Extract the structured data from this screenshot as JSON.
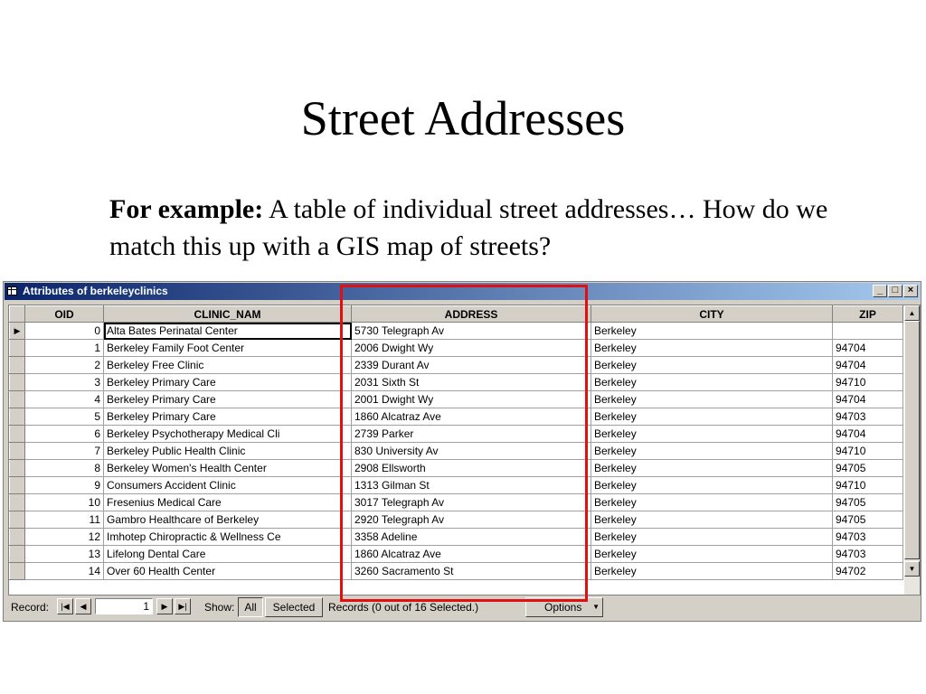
{
  "slide": {
    "title": "Street Addresses",
    "body_bold": "For example:",
    "body_text": " A table of individual street addresses… How do we match this up with a GIS map of streets?"
  },
  "window": {
    "title": "Attributes of berkeleyclinics",
    "minimize": "_",
    "maximize": "□",
    "close": "×"
  },
  "table": {
    "columns": [
      "OID",
      "CLINIC_NAM",
      "ADDRESS",
      "CITY",
      "ZIP"
    ],
    "rows": [
      {
        "oid": "0",
        "name": "Alta Bates Perinatal Center",
        "address": "5730 Telegraph Av",
        "city": "Berkeley",
        "zip": ""
      },
      {
        "oid": "1",
        "name": "Berkeley Family Foot Center",
        "address": "2006 Dwight Wy",
        "city": "Berkeley",
        "zip": "94704"
      },
      {
        "oid": "2",
        "name": "Berkeley Free Clinic",
        "address": "2339 Durant Av",
        "city": "Berkeley",
        "zip": "94704"
      },
      {
        "oid": "3",
        "name": "Berkeley Primary Care",
        "address": "2031 Sixth St",
        "city": "Berkeley",
        "zip": "94710"
      },
      {
        "oid": "4",
        "name": "Berkeley Primary Care",
        "address": "2001 Dwight Wy",
        "city": "Berkeley",
        "zip": "94704"
      },
      {
        "oid": "5",
        "name": "Berkeley Primary Care",
        "address": "1860 Alcatraz Ave",
        "city": "Berkeley",
        "zip": "94703"
      },
      {
        "oid": "6",
        "name": "Berkeley Psychotherapy Medical Cli",
        "address": "2739 Parker",
        "city": "Berkeley",
        "zip": "94704"
      },
      {
        "oid": "7",
        "name": "Berkeley Public Health Clinic",
        "address": "830 University Av",
        "city": "Berkeley",
        "zip": "94710"
      },
      {
        "oid": "8",
        "name": "Berkeley Women's Health Center",
        "address": "2908 Ellsworth",
        "city": "Berkeley",
        "zip": "94705"
      },
      {
        "oid": "9",
        "name": "Consumers Accident Clinic",
        "address": "1313 Gilman St",
        "city": "Berkeley",
        "zip": "94710"
      },
      {
        "oid": "10",
        "name": "Fresenius Medical Care",
        "address": "3017 Telegraph Av",
        "city": "Berkeley",
        "zip": "94705"
      },
      {
        "oid": "11",
        "name": "Gambro Healthcare of Berkeley",
        "address": "2920 Telegraph Av",
        "city": "Berkeley",
        "zip": "94705"
      },
      {
        "oid": "12",
        "name": "Imhotep Chiropractic & Wellness Ce",
        "address": "3358 Adeline",
        "city": "Berkeley",
        "zip": "94703"
      },
      {
        "oid": "13",
        "name": "Lifelong Dental Care",
        "address": "1860 Alcatraz Ave",
        "city": "Berkeley",
        "zip": "94703"
      },
      {
        "oid": "14",
        "name": "Over 60 Health Center",
        "address": "3260 Sacramento St",
        "city": "Berkeley",
        "zip": "94702"
      }
    ]
  },
  "statusbar": {
    "record_label": "Record:",
    "record_value": "1",
    "show_label": "Show:",
    "all_button": "All",
    "selected_button": "Selected",
    "records_text": "Records (0 out of 16 Selected.)",
    "options_button": "Options"
  },
  "colors": {
    "highlight": "#e01010",
    "titlebar_start": "#0a246a",
    "titlebar_end": "#a6caf0",
    "chrome": "#d4d0c8"
  }
}
